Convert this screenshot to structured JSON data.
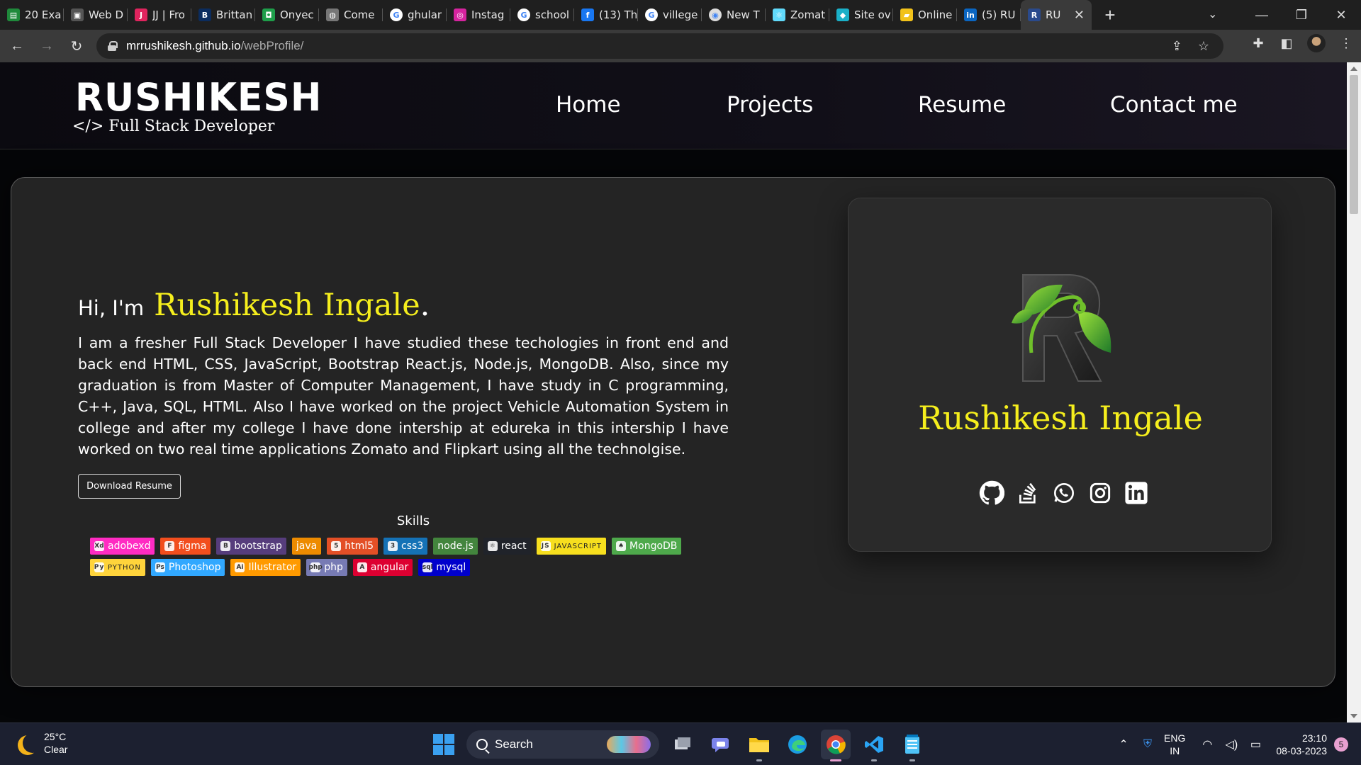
{
  "browser": {
    "tabs": [
      {
        "title": "20 Exa",
        "icon": "sheet-icon",
        "color": "#1f8a3b",
        "glyph": "▤"
      },
      {
        "title": "Web D",
        "icon": "image-icon",
        "color": "#555555",
        "glyph": "▣"
      },
      {
        "title": "JJ | Fro",
        "icon": "jj-icon",
        "color": "#e0245e",
        "glyph": "J"
      },
      {
        "title": "Brittan",
        "icon": "britannica-icon",
        "color": "#0b2c5e",
        "glyph": "B"
      },
      {
        "title": "Onyec",
        "icon": "onyeka-icon",
        "color": "#1e9e4a",
        "glyph": "◘"
      },
      {
        "title": "Come",
        "icon": "globe-icon",
        "color": "#777777",
        "glyph": "◍"
      },
      {
        "title": "ghular",
        "icon": "google-icon",
        "color": "#ffffff",
        "glyph": "G"
      },
      {
        "title": "Instag",
        "icon": "instagram-icon",
        "color": "#d6249f",
        "glyph": "◎"
      },
      {
        "title": "school",
        "icon": "google-icon",
        "color": "#ffffff",
        "glyph": "G"
      },
      {
        "title": "(13) Th",
        "icon": "facebook-icon",
        "color": "#1877f2",
        "glyph": "f"
      },
      {
        "title": "villege",
        "icon": "google-icon",
        "color": "#ffffff",
        "glyph": "G"
      },
      {
        "title": "New T",
        "icon": "chrome-icon",
        "color": "#dddddd",
        "glyph": "◉"
      },
      {
        "title": "Zomat",
        "icon": "react-icon",
        "color": "#61dafb",
        "glyph": "⚛"
      },
      {
        "title": "Site ov",
        "icon": "diamond-icon",
        "color": "#1ab0c8",
        "glyph": "◆"
      },
      {
        "title": "Online",
        "icon": "folder-icon",
        "color": "#f2c21a",
        "glyph": "▰"
      },
      {
        "title": "(5) RU",
        "icon": "linkedin-icon",
        "color": "#0a66c2",
        "glyph": "in"
      }
    ],
    "active_tab": {
      "title": "RU",
      "glyph": "R",
      "color": "#2a4a8c"
    },
    "url_host": "mrrushikesh.github.io",
    "url_path": "/webProfile/"
  },
  "site": {
    "logo_name": "RUSHIKESH",
    "logo_tagline": "</> Full Stack Developer",
    "nav": [
      "Home",
      "Projects",
      "Resume",
      "Contact me"
    ],
    "greeting_prefix": "Hi, I'm",
    "greeting_name": "Rushikesh Ingale",
    "greeting_suffix": ".",
    "bio": "I am a fresher Full Stack Developer I have studied these techologies in front end and back end HTML, CSS, JavaScript, Bootstrap React.js, Node.js, MongoDB. Also, since my graduation is from Master of Computer Management, I have study in C programming, C++, Java, SQL, HTML. Also I have worked on the project Vehicle Automation System in college and after my college I have done intership at edureka in this intership I have worked on two real time applications Zomato and Flipkart using all the technolgise.",
    "download_button": "Download Resume",
    "skills_title": "Skills",
    "skills_row1": [
      {
        "label": "adobexd",
        "bg": "#ff2bc2",
        "glyph": "Xd"
      },
      {
        "label": "figma",
        "bg": "#f24e1e",
        "glyph": "F"
      },
      {
        "label": "bootstrap",
        "bg": "#563d7c",
        "glyph": "B"
      },
      {
        "label": "java",
        "bg": "#ed8b00",
        "glyph": ""
      },
      {
        "label": "html5",
        "bg": "#e34f26",
        "glyph": "5"
      },
      {
        "label": "css3",
        "bg": "#1572b6",
        "glyph": "3"
      },
      {
        "label": "node.js",
        "bg": "#43853d",
        "glyph": ""
      },
      {
        "label": "react",
        "bg": "#20232a",
        "glyph": "⚛"
      },
      {
        "label": "JAVASCRIPT",
        "bg": "#f7df1e",
        "glyph": "JS"
      },
      {
        "label": "MongoDB",
        "bg": "#4ea94b",
        "glyph": "♠"
      }
    ],
    "skills_row2": [
      {
        "label": "PYTHON",
        "bg": "#ffd43b",
        "glyph": "Py"
      },
      {
        "label": "Photoshop",
        "bg": "#31a8ff",
        "glyph": "Ps"
      },
      {
        "label": "Illustrator",
        "bg": "#ff9a00",
        "glyph": "Ai"
      },
      {
        "label": "php",
        "bg": "#777bb4",
        "glyph": "php"
      },
      {
        "label": "angular",
        "bg": "#dd0031",
        "glyph": "A"
      },
      {
        "label": "mysql",
        "bg": "#0000cc",
        "glyph": "sql"
      }
    ],
    "profile_name": "Rushikesh Ingale",
    "social_icons": [
      "github-icon",
      "stackoverflow-icon",
      "whatsapp-icon",
      "instagram-icon",
      "linkedin-icon"
    ],
    "accent_color": "#f5ee1d"
  },
  "taskbar": {
    "temperature": "25°C",
    "weather": "Clear",
    "search_placeholder": "Search",
    "lang_top": "ENG",
    "lang_bottom": "IN",
    "time": "23:10",
    "date": "08-03-2023",
    "notifications": "5"
  }
}
